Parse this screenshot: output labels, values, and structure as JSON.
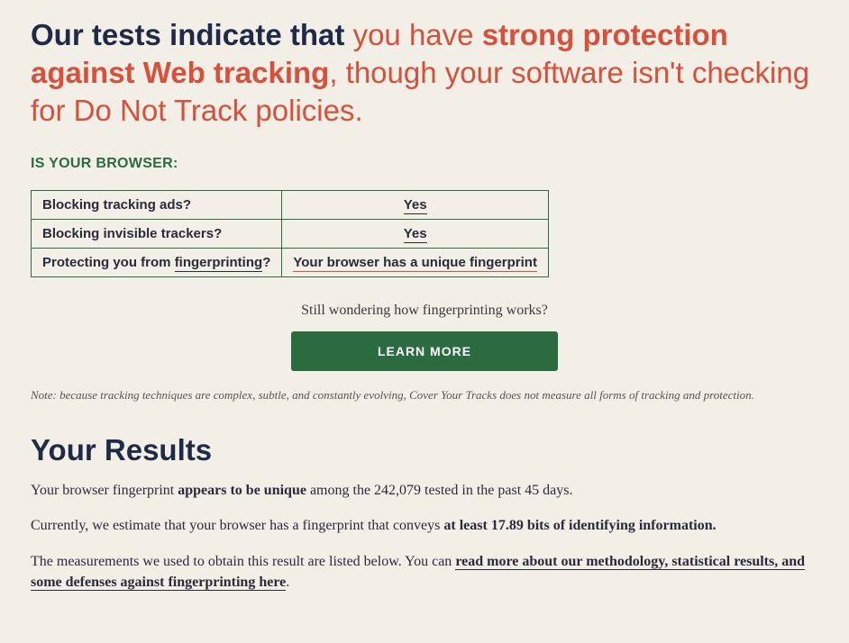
{
  "headline": {
    "prefix_dark": "Our tests indicate that ",
    "mid_light": "you have ",
    "strong_red": "strong protection against Web tracking",
    "tail_light": ", though your software isn't checking for Do Not Track policies."
  },
  "section_label": "IS YOUR BROWSER:",
  "status_rows": [
    {
      "question_pre": "Blocking tracking ads?",
      "question_link": "",
      "question_post": "",
      "answer": "Yes",
      "answer_red": false
    },
    {
      "question_pre": "Blocking invisible trackers?",
      "question_link": "",
      "question_post": "",
      "answer": "Yes",
      "answer_red": false
    },
    {
      "question_pre": "Protecting you from ",
      "question_link": "fingerprinting",
      "question_post": "?",
      "answer": "Your browser has a unique fingerprint",
      "answer_red": true
    }
  ],
  "learn": {
    "question": "Still wondering how fingerprinting works?",
    "button": "LEARN MORE"
  },
  "note": "Note: because tracking techniques are complex, subtle, and constantly evolving, Cover Your Tracks does not measure all forms of tracking and protection.",
  "results": {
    "heading": "Your Results",
    "p1_pre": "Your browser fingerprint ",
    "p1_strong": "appears to be unique",
    "p1_post": " among the 242,079 tested in the past 45 days.",
    "p2_pre": "Currently, we estimate that your browser has a fingerprint that conveys ",
    "p2_strong": "at least 17.89 bits of identifying information.",
    "p3_pre": "The measurements we used to obtain this result are listed below. You can ",
    "p3_link": "read more about our methodology, statistical results, and some defenses against fingerprinting here",
    "p3_post": "."
  }
}
